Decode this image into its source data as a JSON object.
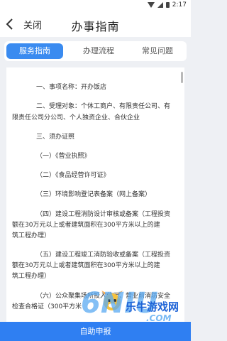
{
  "status_bar": {
    "time": "2:17"
  },
  "nav": {
    "close_label": "关闭",
    "title": "办事指南"
  },
  "tabs": [
    {
      "label": "服务指南",
      "active": true
    },
    {
      "label": "办理流程",
      "active": false
    },
    {
      "label": "常见问题",
      "active": false
    }
  ],
  "content": {
    "lines": [
      "一、事项名称：开办饭店",
      "二、受理对象：个体工商户、有限责任公司、有",
      "限责任公司分公司、个人独资企业、合伙企业",
      "三、须办证照",
      "（一）《营业执照》",
      "（二）《食品经营许可证》",
      "（三）环境影响登记表备案（网上备案）",
      "（四）建设工程消防设计审核或备案（工程投资",
      "额在30万元以上或者建筑面积在300平方米以上的建",
      "筑工程办理）",
      "（五）建设工程竣工消防验收或备案（工程投资",
      "额在30万元以上或者建筑面积在300平方米以上的建",
      "筑工程办理）",
      "（六）公众聚集场所投入使用、营业前消防安全",
      "检查合格证（300平方米"
    ]
  },
  "footer": {
    "label": "自助申报"
  },
  "watermark": {
    "text": "乐牛游戏网",
    "brand": "6NIU",
    "domain": ".COM"
  },
  "colors": {
    "accent": "#3a8bf0",
    "footer": "#2f7ff2"
  }
}
